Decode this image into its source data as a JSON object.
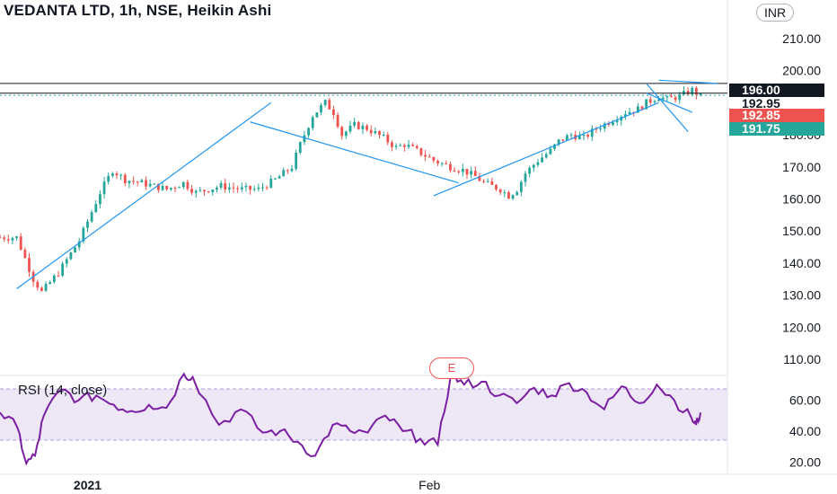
{
  "title": "VEDANTA LTD, 1h, NSE, Heikin Ashi",
  "currency": "INR",
  "rsi_label": "RSI (14, close)",
  "event_marker": "E",
  "price_tags": [
    {
      "value": "196.00",
      "bg": "#131722",
      "fg": "#ffffff"
    },
    {
      "value": "192.95",
      "bg": "#ffffff",
      "fg": "#131722"
    },
    {
      "value": "192.85",
      "bg": "#ef5350",
      "fg": "#ffffff"
    },
    {
      "value": "191.75",
      "bg": "#26a69a",
      "fg": "#ffffff"
    }
  ],
  "colors": {
    "up": "#26a69a",
    "down": "#ef5350",
    "trendline": "#2196f3",
    "rsi_line": "#7b1fa2",
    "rsi_band": "#ede7f6",
    "axis_text": "#131722"
  },
  "chart_data": [
    {
      "type": "candlestick",
      "style": "Heikin Ashi",
      "title": "VEDANTA LTD, 1h, NSE, Heikin Ashi",
      "yticks": [
        "210.00",
        "200.00",
        "180.00",
        "170.00",
        "160.00",
        "150.00",
        "140.00",
        "130.00",
        "120.00",
        "110.00"
      ],
      "xticks": [
        "2021",
        "Feb"
      ],
      "ylim": [
        105,
        222
      ],
      "horizontal_levels": [
        196.0,
        192.95
      ],
      "series": [
        {
          "name": "VEDANTA LTD",
          "path": [
            [
              0,
              148
            ],
            [
              4,
              148
            ],
            [
              8,
              135
            ],
            [
              10,
              131
            ],
            [
              14,
              137
            ],
            [
              19,
              147
            ],
            [
              24,
              162
            ],
            [
              27,
              169
            ],
            [
              30,
              166
            ],
            [
              34,
              165
            ],
            [
              40,
              163
            ],
            [
              44,
              165
            ],
            [
              47,
              162
            ],
            [
              53,
              164
            ],
            [
              58,
              163
            ],
            [
              62,
              163
            ],
            [
              66,
              166
            ],
            [
              70,
              170
            ],
            [
              72,
              177
            ],
            [
              75,
              186
            ],
            [
              78,
              190
            ],
            [
              80,
              187
            ],
            [
              82,
              180
            ],
            [
              85,
              183
            ],
            [
              88,
              182
            ],
            [
              92,
              179
            ],
            [
              95,
              176
            ],
            [
              97,
              177
            ],
            [
              100,
              175
            ],
            [
              104,
              172
            ],
            [
              108,
              170
            ],
            [
              111,
              169
            ],
            [
              114,
              167
            ],
            [
              116,
              165
            ],
            [
              120,
              163
            ],
            [
              122,
              161
            ],
            [
              124,
              163
            ],
            [
              126,
              168
            ],
            [
              129,
              172
            ],
            [
              132,
              175
            ],
            [
              134,
              178
            ],
            [
              137,
              180
            ],
            [
              140,
              179
            ],
            [
              143,
              182
            ],
            [
              146,
              184
            ],
            [
              150,
              187
            ],
            [
              153,
              188
            ],
            [
              155,
              190
            ],
            [
              158,
              192
            ],
            [
              160,
              191
            ],
            [
              163,
              192
            ],
            [
              166,
              194
            ],
            [
              168,
              192
            ]
          ],
          "x_range": [
            0,
            168
          ],
          "last": {
            "open": 192.85,
            "close": 191.75
          }
        }
      ],
      "trendlines": [
        {
          "from": [
            4,
            132
          ],
          "to": [
            65,
            190
          ]
        },
        {
          "from": [
            60,
            184
          ],
          "to": [
            110,
            165
          ]
        },
        {
          "from": [
            104,
            161
          ],
          "to": [
            158,
            190
          ]
        },
        {
          "from": [
            155,
            196
          ],
          "to": [
            165,
            181
          ]
        },
        {
          "from": [
            155,
            193
          ],
          "to": [
            166,
            187
          ]
        },
        {
          "from": [
            158,
            197
          ],
          "to": [
            172,
            196
          ]
        }
      ]
    },
    {
      "type": "line",
      "title": "RSI (14, close)",
      "yticks": [
        "60.00",
        "40.00",
        "20.00"
      ],
      "ylim": [
        12,
        76
      ],
      "band": [
        30,
        70
      ],
      "series": [
        {
          "name": "RSI (14, close)",
          "points": [
            [
              0,
              52
            ],
            [
              4,
              42
            ],
            [
              6,
              19
            ],
            [
              8,
              24
            ],
            [
              10,
              50
            ],
            [
              14,
              67
            ],
            [
              18,
              60
            ],
            [
              22,
              63
            ],
            [
              26,
              57
            ],
            [
              30,
              53
            ],
            [
              34,
              57
            ],
            [
              38,
              55
            ],
            [
              42,
              77
            ],
            [
              44,
              75
            ],
            [
              50,
              44
            ],
            [
              55,
              54
            ],
            [
              60,
              39
            ],
            [
              64,
              40
            ],
            [
              68,
              33
            ],
            [
              72,
              24
            ],
            [
              76,
              44
            ],
            [
              80,
              40
            ],
            [
              84,
              39
            ],
            [
              88,
              50
            ],
            [
              92,
              40
            ],
            [
              96,
              35
            ],
            [
              100,
              31
            ],
            [
              103,
              77
            ],
            [
              106,
              70
            ],
            [
              110,
              72
            ],
            [
              114,
              63
            ],
            [
              118,
              58
            ],
            [
              122,
              68
            ],
            [
              126,
              63
            ],
            [
              130,
              71
            ],
            [
              134,
              65
            ],
            [
              138,
              54
            ],
            [
              142,
              69
            ],
            [
              146,
              58
            ],
            [
              150,
              70
            ],
            [
              154,
              60
            ],
            [
              158,
              48
            ],
            [
              159,
              44
            ],
            [
              160,
              52
            ]
          ]
        }
      ]
    }
  ]
}
